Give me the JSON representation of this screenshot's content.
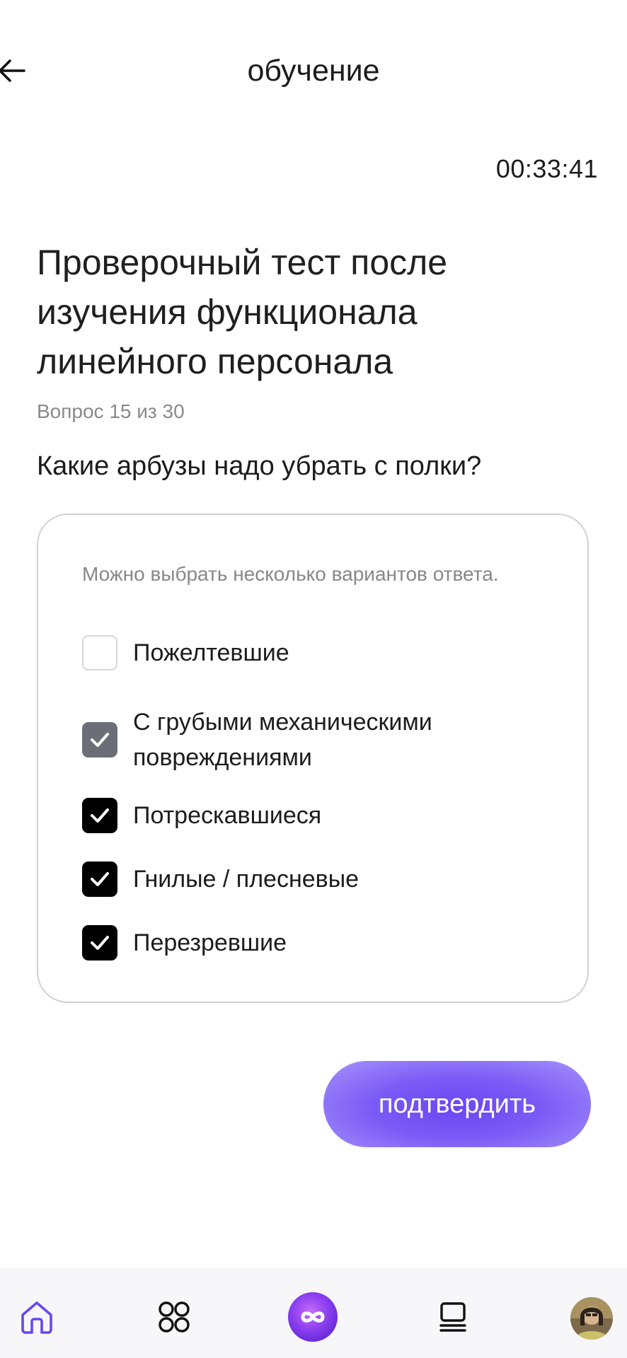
{
  "header": {
    "title": "обучение",
    "back_icon": "arrow-left-icon"
  },
  "timer": "00:33:41",
  "test": {
    "title": "Проверочный тест после изучения функционала линейного персонала",
    "progress": "Вопрос 15 из 30",
    "question": "Какие арбузы надо убрать с полки?"
  },
  "options": {
    "hint": "Можно выбрать несколько вариантов ответа.",
    "items": [
      {
        "label": "Пожелтевшие",
        "checked": false
      },
      {
        "label": "С грубыми механическими повреждениями",
        "checked": true
      },
      {
        "label": "Потрескавшиеся",
        "checked": true
      },
      {
        "label": "Гнилые / плесневые",
        "checked": true
      },
      {
        "label": "Перезревшие",
        "checked": true
      }
    ]
  },
  "confirm_label": "подтвердить",
  "colors": {
    "accent": "#6a46f2",
    "checkbox_checked": "#000000",
    "checkbox_checked_muted": "#6b6e76",
    "hint_text": "#87878c"
  },
  "bottom_nav": {
    "items": [
      {
        "icon": "home-icon",
        "active": true
      },
      {
        "icon": "apps-grid-icon",
        "active": false
      },
      {
        "icon": "infinity-icon",
        "active": false
      },
      {
        "icon": "courses-stack-icon",
        "active": false
      },
      {
        "icon": "avatar",
        "active": false
      }
    ]
  }
}
